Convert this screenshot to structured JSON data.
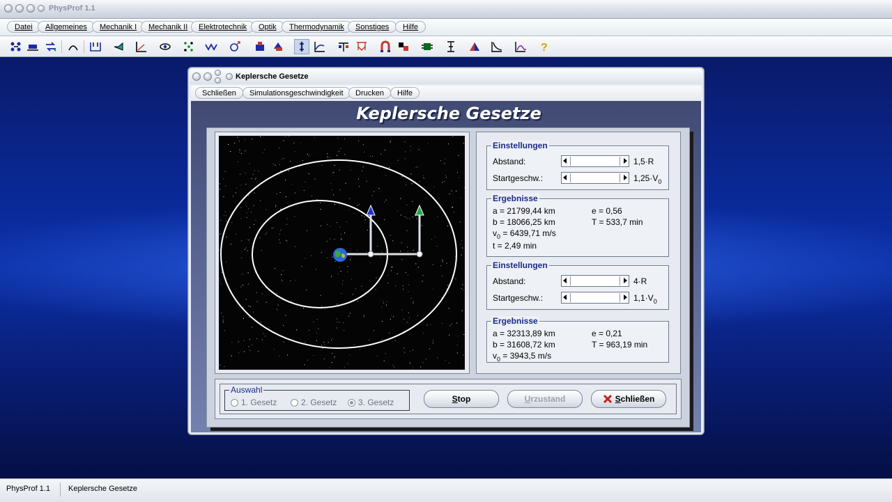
{
  "app": {
    "title": "PhysProf 1.1"
  },
  "menubar": [
    {
      "label": "Datei"
    },
    {
      "label": "Allgemeines"
    },
    {
      "label": "Mechanik I"
    },
    {
      "label": "Mechanik II"
    },
    {
      "label": "Elektrotechnik"
    },
    {
      "label": "Optik"
    },
    {
      "label": "Thermodynamik"
    },
    {
      "label": "Sonstiges"
    },
    {
      "label": "Hilfe"
    }
  ],
  "toolbar": {
    "icons": [
      "particles-icon",
      "cart-icon",
      "arrows-icon",
      "pendulum-icon",
      "spring-icon",
      "lever-icon",
      "incline-icon",
      "eye-icon",
      "dots-icon",
      "wave-icon",
      "atom-icon",
      "magnet-icon",
      "heat-icon",
      "vertical-bar-icon",
      "graph-icon",
      "scale-icon",
      "bridge-icon",
      "molecule-icon",
      "plug-icon",
      "chip-icon",
      "prism-icon",
      "curve-icon",
      "curve2-icon",
      "help-icon"
    ]
  },
  "window": {
    "title": "Keplersche Gesetze",
    "heading": "Keplersche Gesetze",
    "menu": [
      {
        "label": "Schließen"
      },
      {
        "label": "Simulationsgeschwindigkeit"
      },
      {
        "label": "Drucken"
      },
      {
        "label": "Hilfe"
      }
    ]
  },
  "planet1": {
    "settings_title": "Einstellungen",
    "abstand_label": "Abstand:",
    "abstand_value": "1,5·R",
    "start_label": "Startgeschw.:",
    "start_value": "1,25·V",
    "start_sub": "0",
    "results_title": "Ergebnisse",
    "a": "a = 21799,44 km",
    "b": "b = 18066,25 km",
    "v": "= 6439,71 m/s",
    "v_prefix": "v",
    "v_sub": "0",
    "t": "t =  2,49 min",
    "e": "e = 0,56",
    "T": "T = 533,7 min"
  },
  "planet2": {
    "settings_title": "Einstellungen",
    "abstand_label": "Abstand:",
    "abstand_value": "4·R",
    "start_label": "Startgeschw.:",
    "start_value": "1,1·V",
    "start_sub": "0",
    "results_title": "Ergebnisse",
    "a": "a = 32313,89 km",
    "b": "b = 31608,72 km",
    "v": "=  3943,5 m/s",
    "v_prefix": "v",
    "v_sub": "0",
    "e": "e = 0,21",
    "T": "T = 963,19 min"
  },
  "auswahl": {
    "label": "Auswahl",
    "options": [
      "1. Gesetz",
      "2. Gesetz",
      "3. Gesetz"
    ],
    "selected": "3. Gesetz"
  },
  "buttons": {
    "stop": "Stop",
    "reset": "Urzustand",
    "close": "Schließen"
  },
  "statusbar": {
    "left": "PhysProf 1.1",
    "right": "Keplersche Gesetze"
  },
  "colors": {
    "desktop": "#0b2fa6",
    "heading_bg": "#5b6695",
    "group_label": "#1b2a8a"
  }
}
